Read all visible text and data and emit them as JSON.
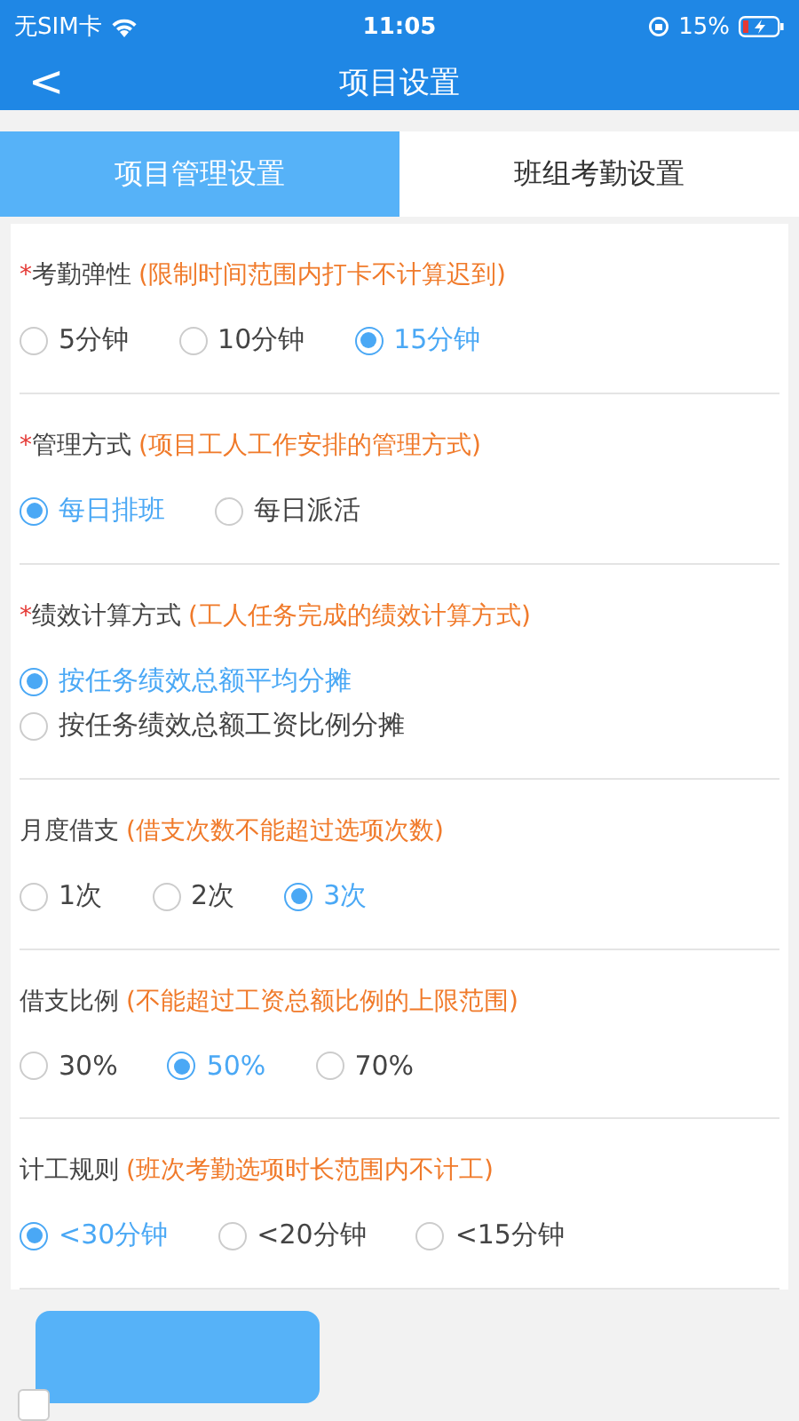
{
  "status_bar": {
    "carrier": "无SIM卡",
    "time": "11:05",
    "battery": "15%"
  },
  "nav": {
    "back": "<",
    "title": "项目设置"
  },
  "tabs": [
    {
      "label": "项目管理设置",
      "selected": true
    },
    {
      "label": "班组考勤设置",
      "selected": false
    }
  ],
  "sections": [
    {
      "required_mark": "*",
      "label": "考勤弹性",
      "hint": "(限制时间范围内打卡不计算迟到)",
      "kind": "inline",
      "options": [
        {
          "label": "5分钟",
          "selected": false
        },
        {
          "label": "10分钟",
          "selected": false
        },
        {
          "label": "15分钟",
          "selected": true
        }
      ]
    },
    {
      "required_mark": "*",
      "label": "管理方式",
      "hint": "(项目工人工作安排的管理方式)",
      "kind": "inline",
      "options": [
        {
          "label": "每日排班",
          "selected": true
        },
        {
          "label": "每日派活",
          "selected": false
        }
      ]
    },
    {
      "required_mark": "*",
      "label": "绩效计算方式",
      "hint": "(工人任务完成的绩效计算方式)",
      "kind": "stacked",
      "options": [
        {
          "label": "按任务绩效总额平均分摊",
          "selected": true
        },
        {
          "label": "按任务绩效总额工资比例分摊",
          "selected": false
        }
      ]
    },
    {
      "label": "月度借支",
      "hint": "(借支次数不能超过选项次数)",
      "kind": "inline",
      "options": [
        {
          "label": "1次",
          "selected": false
        },
        {
          "label": "2次",
          "selected": false
        },
        {
          "label": "3次",
          "selected": true
        }
      ]
    },
    {
      "label": "借支比例",
      "hint": "(不能超过工资总额比例的上限范围)",
      "kind": "inline",
      "options": [
        {
          "label": "30%",
          "selected": false
        },
        {
          "label": "50%",
          "selected": true
        },
        {
          "label": "70%",
          "selected": false
        }
      ]
    },
    {
      "label": "计工规则",
      "hint": "(班次考勤选项时长范围内不计工)",
      "kind": "inline",
      "options": [
        {
          "label": "<30分钟",
          "selected": true
        },
        {
          "label": "<20分钟",
          "selected": false
        },
        {
          "label": "<15分钟",
          "selected": false
        }
      ]
    }
  ],
  "footer": {
    "checkbox": {
      "checked": false
    }
  }
}
